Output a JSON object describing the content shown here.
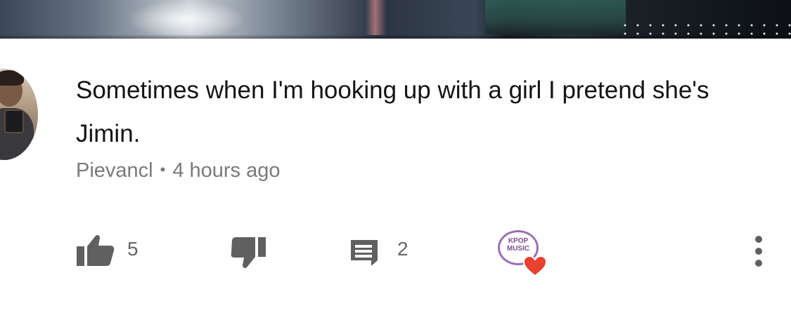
{
  "comment": {
    "text": "Sometimes when I'm hooking up with a girl I pretend she's Jimin.",
    "author": "Pievancl",
    "separator": "•",
    "time": "4 hours ago"
  },
  "actions": {
    "like_count": "5",
    "reply_count": "2",
    "like_icon": "thumbs-up-icon",
    "dislike_icon": "thumbs-down-icon",
    "reply_icon": "reply-comment-icon",
    "creator_heart_icon": "creator-heart-icon",
    "more_icon": "vertical-ellipsis-icon"
  },
  "creator_badge": {
    "text_line1": "KPOP",
    "text_line2": "MUSIC",
    "heart_color": "#e8412f",
    "ring_color": "#9a6fb3"
  },
  "colors": {
    "text_primary": "#141414",
    "text_secondary": "#7a7a7a",
    "icon_gray": "#606060"
  }
}
